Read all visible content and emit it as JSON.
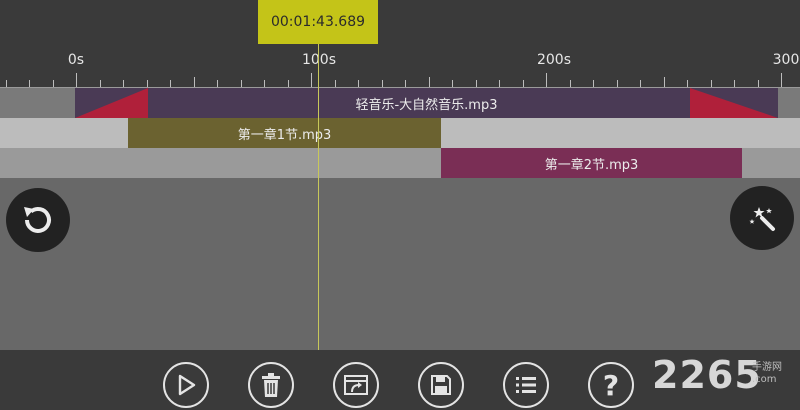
{
  "header": {
    "current_time": "00:01:43.689"
  },
  "ruler": {
    "labels": [
      "0s",
      "100s",
      "200s",
      "300"
    ]
  },
  "tracks": [
    {
      "clip_label": "轻音乐-大自然音乐.mp3"
    },
    {
      "clip_label": "第一章1节.mp3"
    },
    {
      "clip_label": "第一章2节.mp3"
    }
  ],
  "controls": {
    "undo_icon": "undo-icon",
    "magic_icon": "magic-wand-icon"
  },
  "toolbar": {
    "tools": [
      {
        "name": "play-icon"
      },
      {
        "name": "trash-icon"
      },
      {
        "name": "export-icon"
      },
      {
        "name": "save-icon"
      },
      {
        "name": "list-icon"
      },
      {
        "name": "help-icon",
        "glyph": "?"
      }
    ]
  },
  "watermark": {
    "number": "2265",
    "sub1": "手游网",
    "sub2": ".com"
  },
  "colors": {
    "time_box": "#c4c418",
    "clip_music": "#4a3a55",
    "fade_marker": "#b0203a",
    "clip_chapter1": "#6b6230",
    "clip_chapter2": "#7a2e55",
    "playhead": "#c8c85a"
  }
}
